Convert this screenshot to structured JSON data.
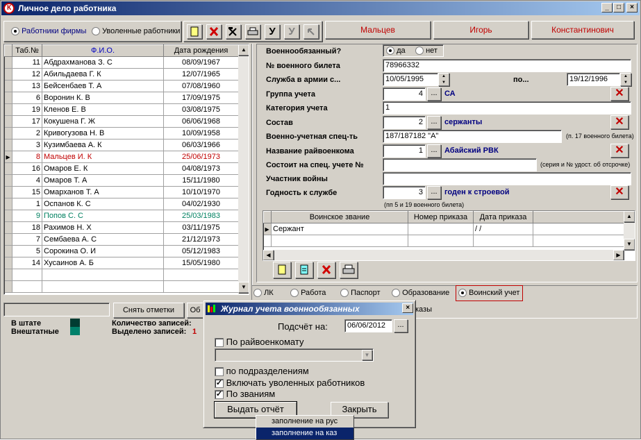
{
  "window": {
    "title": "Личное дело работника",
    "icon_letter": "К",
    "controls": [
      "_",
      "□",
      "×"
    ]
  },
  "filter": {
    "option1": "Работники фирмы",
    "option2": "Уволенные работники",
    "selected": "option1"
  },
  "name_tabs": [
    "Мальцев",
    "Игорь",
    "Константинович"
  ],
  "table": {
    "columns": [
      "Таб.№",
      "Ф.И.О.",
      "Дата рождения"
    ],
    "rows": [
      {
        "num": "11",
        "name": "Абдрахманова З. С",
        "dob": "08/09/1967",
        "style": "normal"
      },
      {
        "num": "12",
        "name": "Абильдаева Г. К",
        "dob": "12/07/1965",
        "style": "normal"
      },
      {
        "num": "13",
        "name": "Бейсенбаев Т. А",
        "dob": "07/08/1960",
        "style": "normal"
      },
      {
        "num": "6",
        "name": "Воронин К. В",
        "dob": "17/09/1975",
        "style": "normal"
      },
      {
        "num": "19",
        "name": "Кленов Е. В",
        "dob": "03/08/1975",
        "style": "normal"
      },
      {
        "num": "17",
        "name": "Кокушена Г. Ж",
        "dob": "06/06/1968",
        "style": "normal"
      },
      {
        "num": "2",
        "name": "Кривогузова Н. В",
        "dob": "10/09/1958",
        "style": "normal"
      },
      {
        "num": "3",
        "name": "Кузимбаева А. К",
        "dob": "06/03/1966",
        "style": "normal"
      },
      {
        "num": "8",
        "name": "Мальцев И. К",
        "dob": "25/06/1973",
        "style": "current"
      },
      {
        "num": "16",
        "name": "Омаров Е. К",
        "dob": "04/08/1973",
        "style": "normal"
      },
      {
        "num": "4",
        "name": "Омаров Т. А",
        "dob": "15/11/1980",
        "style": "normal"
      },
      {
        "num": "15",
        "name": "Омарханов Т. А",
        "dob": "10/10/1970",
        "style": "normal"
      },
      {
        "num": "1",
        "name": "Оспанов К. С",
        "dob": "04/02/1930",
        "style": "normal"
      },
      {
        "num": "9",
        "name": "Попов С. С",
        "dob": "25/03/1983",
        "style": "green"
      },
      {
        "num": "18",
        "name": "Рахимов Н. Х",
        "dob": "03/11/1975",
        "style": "normal"
      },
      {
        "num": "7",
        "name": "Сембаева А. С",
        "dob": "21/12/1973",
        "style": "normal"
      },
      {
        "num": "5",
        "name": "Сорокина О. И",
        "dob": "05/12/1983",
        "style": "normal"
      },
      {
        "num": "14",
        "name": "Хусаинов А. Б",
        "dob": "15/05/1980",
        "style": "normal"
      }
    ]
  },
  "bottom_left": {
    "clear_marks": "Снять отметки",
    "other_btn": "Об",
    "in_staff": "В штате",
    "freelance": "Внештатные",
    "records_count_label": "Количество записей:",
    "selected_count_label": "Выделено записей:",
    "selected_count_value": "1",
    "staff_color": "#003c32",
    "freelance_color": "#00806a"
  },
  "military": {
    "liable_label": "Военнообязанный?",
    "liable_yes": "да",
    "liable_no": "нет",
    "ticket_label": "№ военного билета",
    "ticket_value": "78966332",
    "service_label": "Служба в армии с...",
    "service_from": "10/05/1995",
    "service_to_label": "по...",
    "service_to": "19/12/1996",
    "group_label": "Группа учета",
    "group_code": "4",
    "group_name": "СА",
    "category_label": "Категория учета",
    "category_value": "1",
    "composition_label": "Состав",
    "composition_code": "2",
    "composition_name": "сержанты",
    "specialty_label": "Военно-учетная спец-ть",
    "specialty_value": "187/187182 \"А\"",
    "specialty_note": "(п. 17 военного билета)",
    "office_label": "Название райвоенкома",
    "office_code": "1",
    "office_name": "Абайский РВК",
    "special_label": "Состоит на спец. учете №",
    "special_note": "(серия и № удост. об отсрочке)",
    "war_label": "Участник войны",
    "fitness_label": "Годность к службе",
    "fitness_code": "3",
    "fitness_name": "годен к строевой",
    "fitness_note": "(пп 5 и 19 военного билета)",
    "dots": "...",
    "remove_mark": "✕"
  },
  "ranks": {
    "columns": [
      "Воинское звание",
      "Номер приказа",
      "Дата приказа"
    ],
    "rows": [
      {
        "rank": "Сержант",
        "order": "",
        "date": " /  /"
      }
    ]
  },
  "section_tabs": {
    "items": [
      "ЛК",
      "Работа",
      "Паспорт",
      "Образование",
      "Воинский учет"
    ],
    "selected": "Воинский учет",
    "hidden_text": "казы"
  },
  "dialog": {
    "title": "Журнал учета военнообязанных",
    "count_label": "Подсчёт на:",
    "count_date": "06/06/2012",
    "by_office_label": "По райвоенкомату",
    "by_office_checked": false,
    "by_divisions_label": "по подразделениям",
    "by_divisions_checked": false,
    "include_fired_label": "Включать уволенных работников",
    "include_fired_checked": true,
    "by_ranks_label": "По званиям",
    "by_ranks_checked": true,
    "report_button": "Выдать отчёт",
    "close_button": "Закрыть"
  },
  "popup_menu": {
    "items": [
      "заполнение на рус",
      "заполнение на каз"
    ],
    "highlighted": "заполнение на каз"
  }
}
